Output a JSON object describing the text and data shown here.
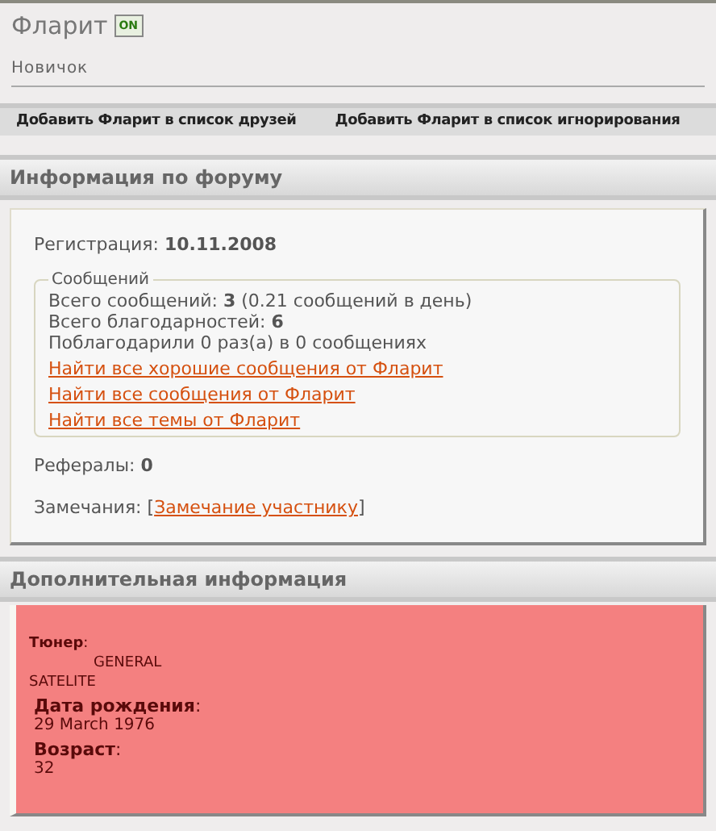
{
  "profile": {
    "username": "Фларит",
    "online_badge": "ON",
    "online": true,
    "rank": "Новичок"
  },
  "actions": [
    "Добавить Фларит в список друзей",
    "Добавить Фларит в список игнорирования"
  ],
  "forum_info": {
    "title": "Информация по форуму",
    "registration": "Регистрация: **10.11.2008**",
    "messages": {
      "legend": "Сообщений",
      "lines": [
        "Всего сообщений: **3** (0.21 сообщений в день)",
        "Всего благодарностей: **6**",
        "Поблагодарили 0 раз(а) в 0 сообщениях"
      ],
      "links": [
        "Найти все хорошие сообщения от Фларит",
        "Найти все сообщения от Фларит",
        "Найти все темы от Фларит"
      ]
    },
    "referrals": "Рефералы: **0**",
    "remarks": {
      "label": "Замечания:",
      "open": "[",
      "link": "Замечание участнику",
      "close": "]"
    }
  },
  "extra": {
    "title": "Дополнительная информация",
    "fields": [
      {
        "kind": "indented",
        "label": "**Тюнер**:",
        "value": "GENERAL SATELITE"
      },
      {
        "kind": "plain",
        "label": "**Дата рождения**:",
        "value": "29 March 1976"
      },
      {
        "kind": "plain",
        "label": "**Возраст**:",
        "value": "32"
      }
    ]
  }
}
